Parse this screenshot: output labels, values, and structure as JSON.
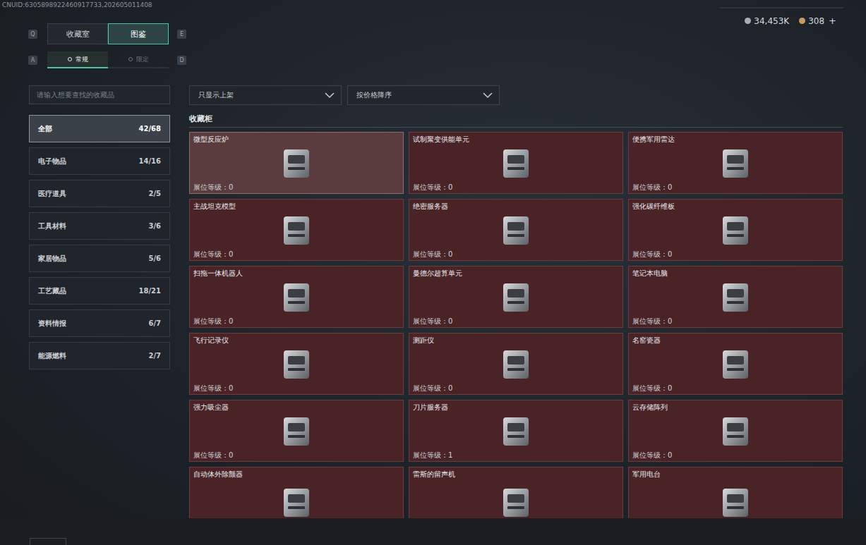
{
  "account": {
    "uid": "CNUID:6305898922460917733,202605011408"
  },
  "currency": [
    {
      "amount": "34,453K"
    },
    {
      "amount": "308",
      "action": "+"
    }
  ],
  "tabs": [
    {
      "label": "收藏室",
      "selected": false
    },
    {
      "label": "图鉴",
      "selected": true
    }
  ],
  "tab_keys": [
    "Q",
    "E"
  ],
  "subtabs": [
    {
      "label": "常规",
      "selected": true
    },
    {
      "label": "限定",
      "selected": false
    }
  ],
  "subtab_keys": [
    "A",
    "D"
  ],
  "search": {
    "placeholder": "请输入想要查找的收藏品"
  },
  "filters": [
    {
      "value": "只显示上架"
    },
    {
      "value": "按价格降序"
    }
  ],
  "categories": [
    {
      "label": "全部",
      "count": "42/68",
      "selected": true
    },
    {
      "label": "电子物品",
      "count": "14/16",
      "selected": false
    },
    {
      "label": "医疗道具",
      "count": "2/5",
      "selected": false
    },
    {
      "label": "工具材料",
      "count": "3/6",
      "selected": false
    },
    {
      "label": "家居物品",
      "count": "5/6",
      "selected": false
    },
    {
      "label": "工艺藏品",
      "count": "18/21",
      "selected": false
    },
    {
      "label": "资料情报",
      "count": "6/7",
      "selected": false
    },
    {
      "label": "能源燃料",
      "count": "2/7",
      "selected": false
    }
  ],
  "section_title": "收藏柜",
  "level_label": "展位等级：",
  "items": [
    {
      "name": "微型反应炉",
      "level": "0",
      "selected": true
    },
    {
      "name": "试制聚变供能单元",
      "level": "0",
      "selected": false
    },
    {
      "name": "便携军用雷达",
      "level": "0",
      "selected": false
    },
    {
      "name": "主战坦克模型",
      "level": "0",
      "selected": false
    },
    {
      "name": "绝密服务器",
      "level": "0",
      "selected": false
    },
    {
      "name": "强化碳纤维板",
      "level": "0",
      "selected": false
    },
    {
      "name": "扫拖一体机器人",
      "level": "0",
      "selected": false
    },
    {
      "name": "曼德尔超算单元",
      "level": "0",
      "selected": false
    },
    {
      "name": "笔记本电脑",
      "level": "0",
      "selected": false
    },
    {
      "name": "飞行记录仪",
      "level": "0",
      "selected": false
    },
    {
      "name": "测距仪",
      "level": "0",
      "selected": false
    },
    {
      "name": "名窑瓷器",
      "level": "0",
      "selected": false
    },
    {
      "name": "强力吸尘器",
      "level": "0",
      "selected": false
    },
    {
      "name": "刀片服务器",
      "level": "1",
      "selected": false
    },
    {
      "name": "云存储阵列",
      "level": "0",
      "selected": false
    },
    {
      "name": "自动体外除颤器",
      "selected": false
    },
    {
      "name": "雷斯的留声机",
      "selected": false
    },
    {
      "name": "军用电台",
      "selected": false
    }
  ]
}
